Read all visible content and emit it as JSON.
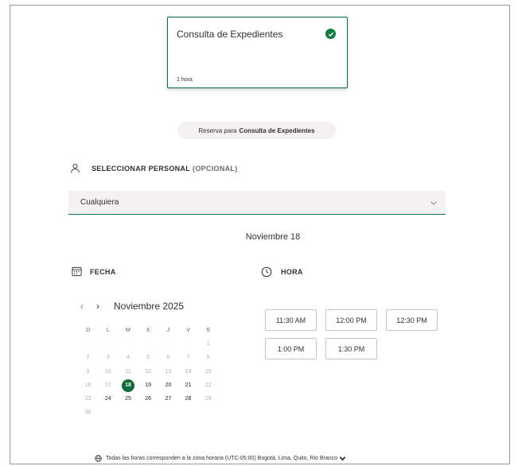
{
  "service": {
    "title": "Consulta de Expedientes",
    "duration": "1 hora"
  },
  "booking": {
    "prefix": "Reserva para",
    "service_name": "Consulta de Expedientes"
  },
  "staff": {
    "heading": "SELECCIONAR PERSONAL",
    "optional": "(OPCIONAL)",
    "selected": "Cualquiera"
  },
  "selected_date": "Noviembre 18",
  "fecha": {
    "heading": "FECHA"
  },
  "hora": {
    "heading": "HORA"
  },
  "calendar": {
    "month_label": "Noviembre 2025",
    "prev_glyph": "‹",
    "next_glyph": "›",
    "weekdays": [
      "D",
      "L",
      "M",
      "X",
      "J",
      "V",
      "S"
    ],
    "weeks": [
      [
        "",
        "",
        "",
        "",
        "",
        "",
        "1"
      ],
      [
        "2",
        "3",
        "4",
        "5",
        "6",
        "7",
        "8"
      ],
      [
        "9",
        "10",
        "11",
        "12",
        "13",
        "14",
        "15"
      ],
      [
        "16",
        "17",
        "18",
        "19",
        "20",
        "21",
        "22"
      ],
      [
        "23",
        "24",
        "25",
        "26",
        "27",
        "28",
        "29"
      ],
      [
        "30",
        "",
        "",
        "",
        "",
        "",
        ""
      ]
    ],
    "available_days": [
      "18",
      "19",
      "20",
      "21",
      "24",
      "25",
      "26",
      "27",
      "28"
    ],
    "selected_day": "18"
  },
  "time_slots": [
    "11:30 AM",
    "12:00 PM",
    "12:30 PM",
    "1:00 PM",
    "1:30 PM"
  ],
  "timezone": {
    "text": "Todas las horas corresponden a la zona horaria  (UTC-05:00) Bogotá, Lima, Quito, Rio Branco"
  },
  "colors": {
    "accent": "#107c41",
    "selected_day": "#0b6a35",
    "field_bg": "#f3f2f1"
  }
}
